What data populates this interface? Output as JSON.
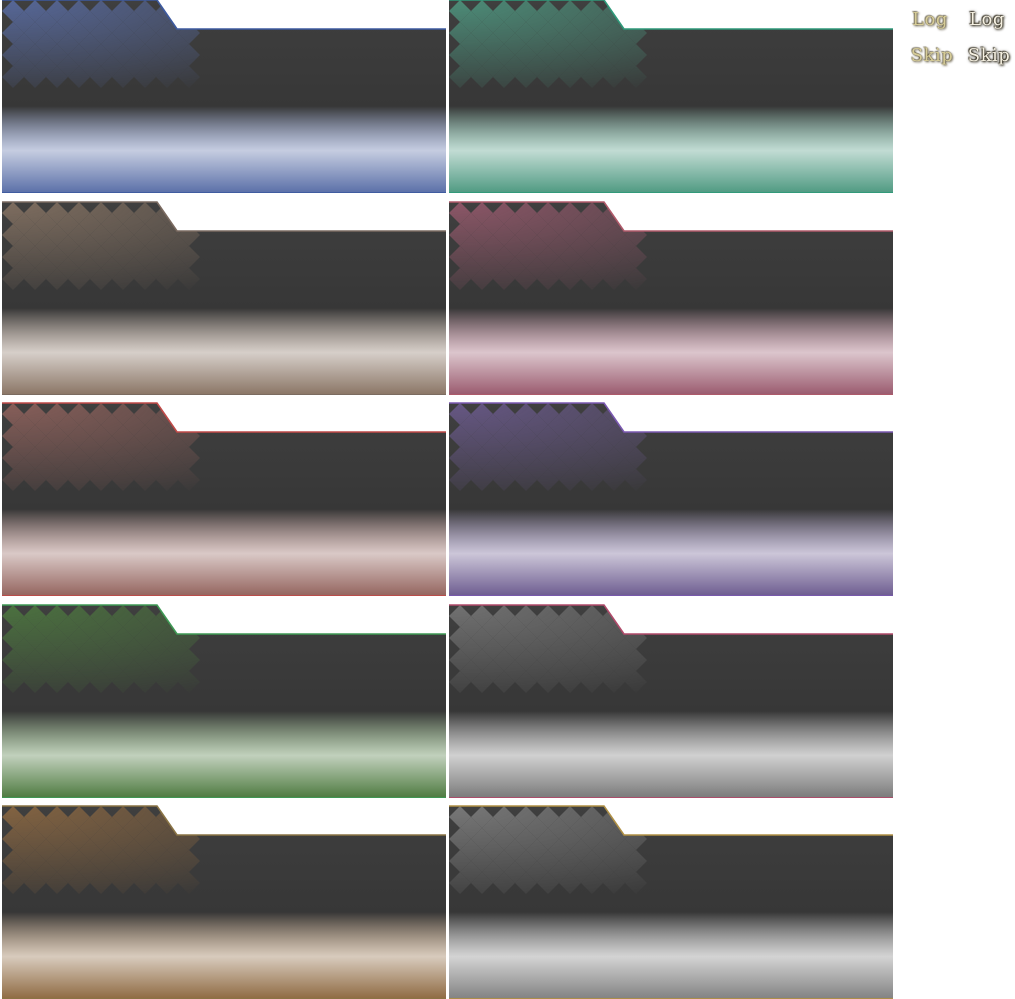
{
  "panels": [
    {
      "name": "blue",
      "accent": "#5a6fa8",
      "edge": "#3d5aa0"
    },
    {
      "name": "teal",
      "accent": "#4f9a82",
      "edge": "#2f9a7a"
    },
    {
      "name": "taupe",
      "accent": "#8a7565",
      "edge": "#7a6a60"
    },
    {
      "name": "rose",
      "accent": "#9a5a6e",
      "edge": "#b05a6a"
    },
    {
      "name": "red",
      "accent": "#94645e",
      "edge": "#c04a48"
    },
    {
      "name": "violet",
      "accent": "#6d5c90",
      "edge": "#7a58b0"
    },
    {
      "name": "green",
      "accent": "#4e7a40",
      "edge": "#3f9a55"
    },
    {
      "name": "gray",
      "accent": "#7a7a7a",
      "edge": "#b04a6a"
    },
    {
      "name": "amber",
      "accent": "#8f6a42",
      "edge": "#8a7445"
    },
    {
      "name": "silver",
      "accent": "#828282",
      "edge": "#b09045"
    }
  ],
  "buttons": {
    "log_normal": "Log",
    "log_active": "Log",
    "skip_normal": "Skip",
    "skip_active": "Skip"
  },
  "colors": {
    "panel_base": "#3f3f3f",
    "panel_shade": "#373737",
    "button_text_normal": "#d6cc98",
    "button_text_active": "#f6f1e2"
  }
}
